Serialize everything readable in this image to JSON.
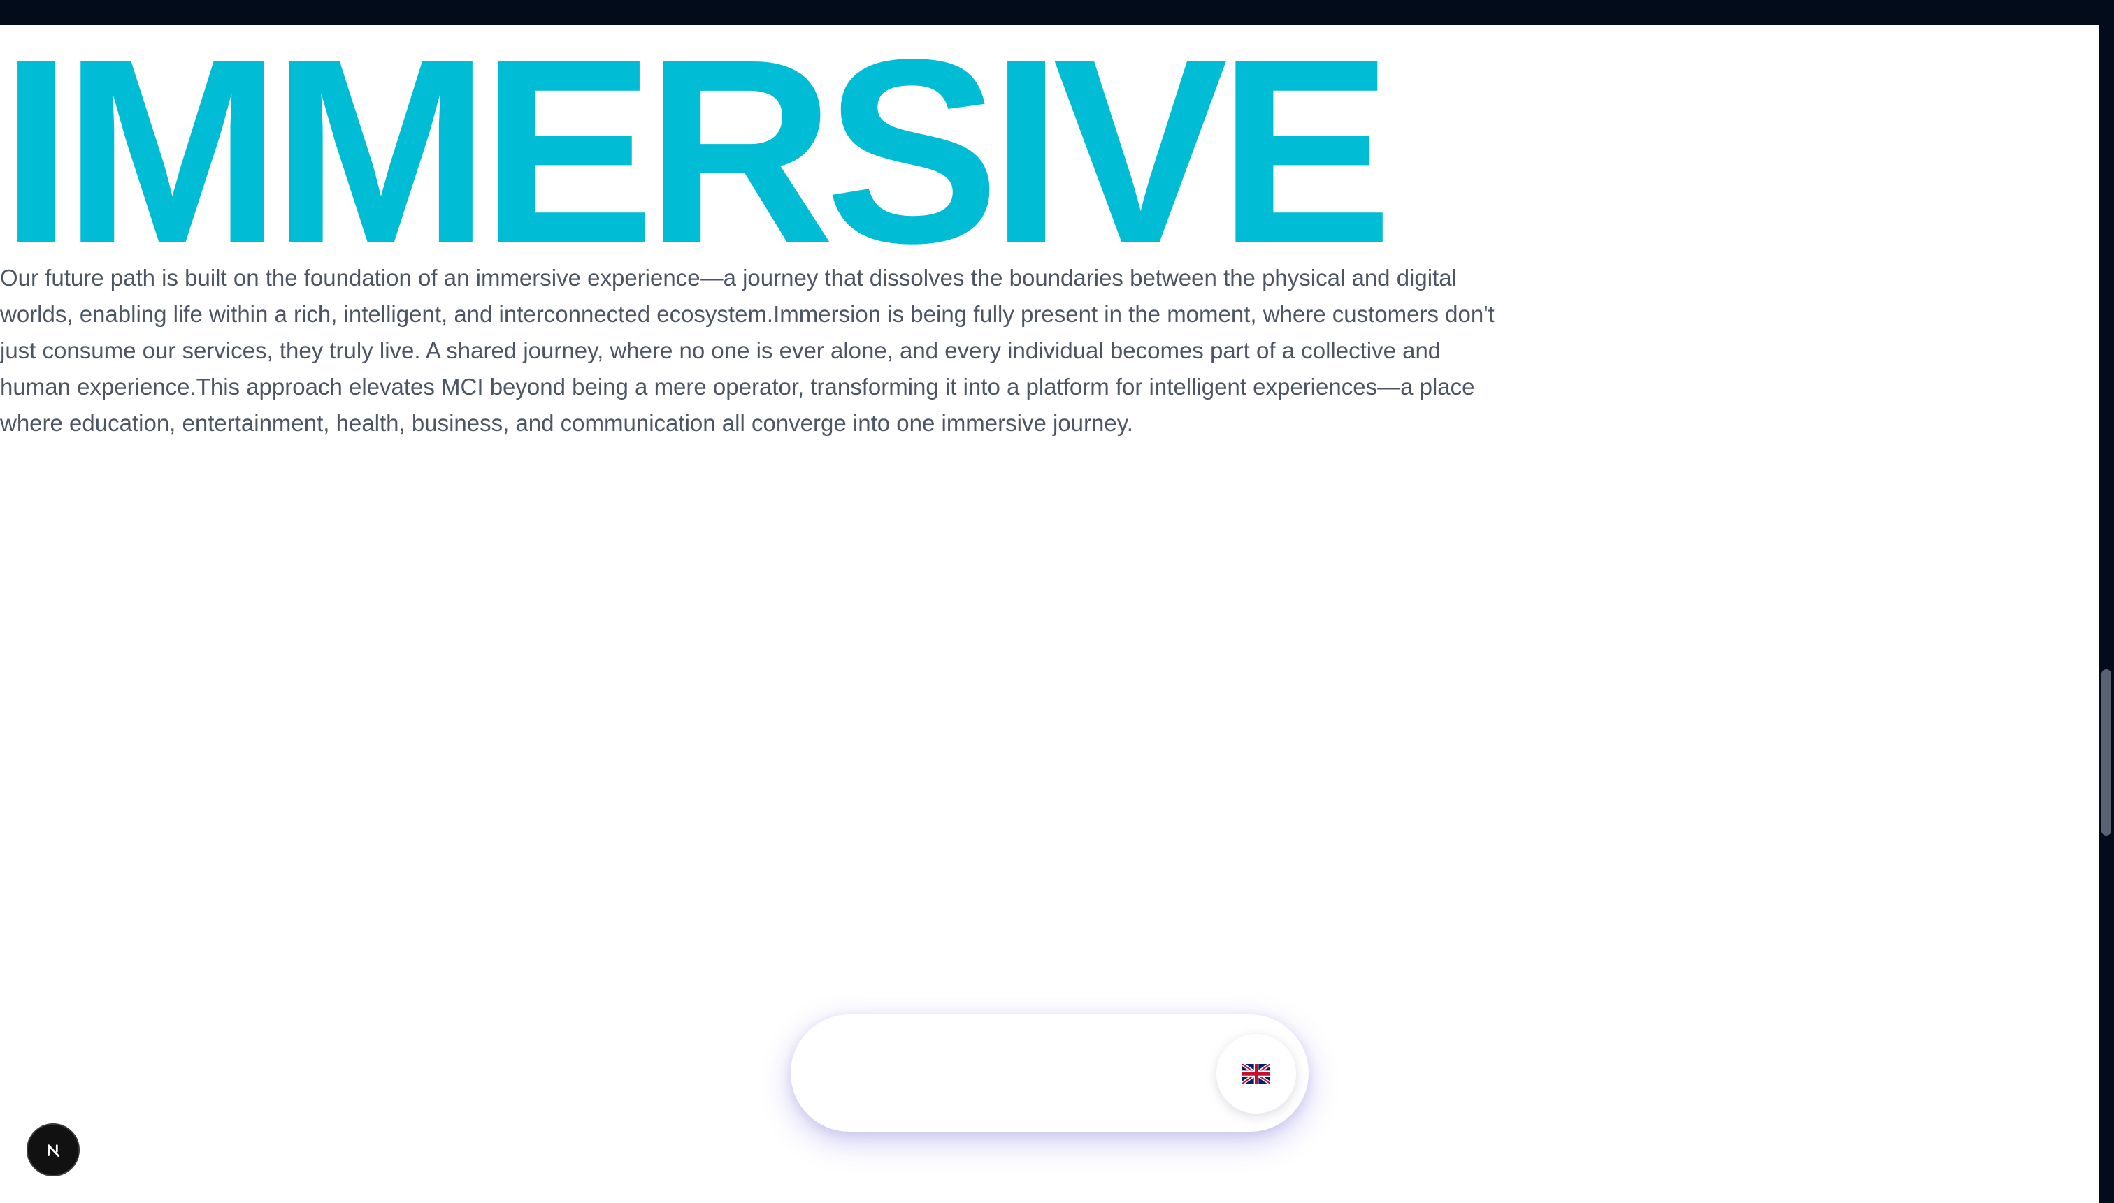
{
  "hero": {
    "title": "IMMERSIVE",
    "copy": "Our future path is built on the foundation of an immersive experience—a journey that dissolves the boundaries between the physical and digital worlds, enabling life within a rich, intelligent, and interconnected ecosystem.Immersion is being fully present in the moment, where customers don't just consume our services, they truly live. A shared journey, where no one is ever alone, and every individual becomes part of a collective and human experience.This approach elevates MCI beyond being a mere operator, transforming it into a platform for intelligent experiences—a place where education, entertainment, health, business, and communication all converge into one immersive journey."
  },
  "controls": {
    "language_icon": "uk-flag-icon",
    "dev_badge_icon": "next-js-icon"
  },
  "colors": {
    "accent": "#00bcd4",
    "topbar": "#020c1b",
    "body_text": "#4b5563"
  }
}
